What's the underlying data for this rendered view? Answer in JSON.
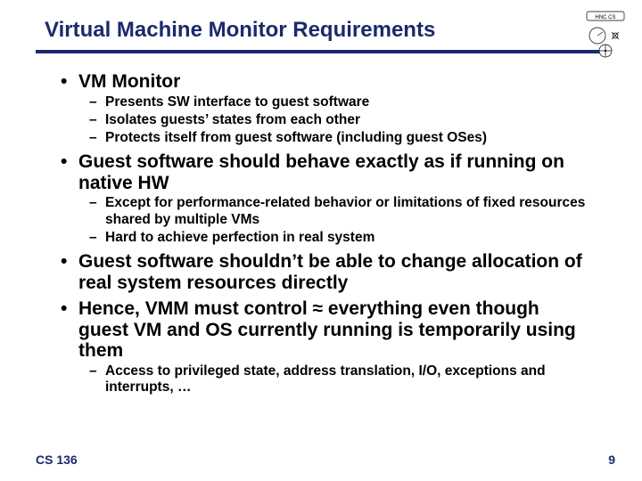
{
  "title": "Virtual Machine Monitor Requirements",
  "footer": {
    "course": "CS 136",
    "page": "9"
  },
  "bullets": [
    {
      "level": 1,
      "text": "VM Monitor"
    },
    {
      "level": 2,
      "text": "Presents SW interface to guest software"
    },
    {
      "level": 2,
      "text": "Isolates guests’ states from each other"
    },
    {
      "level": 2,
      "text": "Protects itself from guest software (including guest OSes)"
    },
    {
      "level": 1,
      "text": "Guest software should behave exactly as if running on native HW"
    },
    {
      "level": 2,
      "text": "Except for performance-related behavior or limitations of fixed resources shared by multiple VMs"
    },
    {
      "level": 2,
      "text": "Hard to achieve perfection in real system"
    },
    {
      "level": 1,
      "text": "Guest software shouldn’t be able to change allocation of real system resources directly"
    },
    {
      "level": 1,
      "text": "Hence, VMM must control ≈ everything even though guest VM and OS currently running is temporarily using them"
    },
    {
      "level": 2,
      "text": "Access to privileged state, address translation, I/O, exceptions and interrupts, …"
    }
  ]
}
